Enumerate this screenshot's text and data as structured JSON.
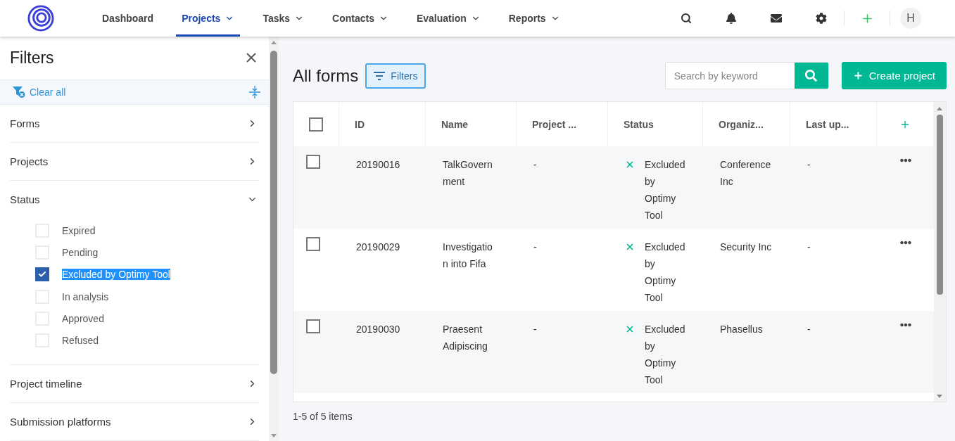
{
  "nav": {
    "items": [
      {
        "label": "Dashboard",
        "dropdown": false,
        "selected": false
      },
      {
        "label": "Projects",
        "dropdown": true,
        "selected": true
      },
      {
        "label": "Tasks",
        "dropdown": true,
        "selected": false
      },
      {
        "label": "Contacts",
        "dropdown": true,
        "selected": false
      },
      {
        "label": "Evaluation",
        "dropdown": true,
        "selected": false
      },
      {
        "label": "Reports",
        "dropdown": true,
        "selected": false
      }
    ],
    "avatar": "H"
  },
  "filters": {
    "title": "Filters",
    "clear": "Clear all",
    "sections": [
      {
        "label": "Forms",
        "expanded": false
      },
      {
        "label": "Projects",
        "expanded": false
      },
      {
        "label": "Status",
        "expanded": true,
        "options": [
          {
            "label": "Expired",
            "checked": false,
            "highlighted": false
          },
          {
            "label": "Pending",
            "checked": false,
            "highlighted": false
          },
          {
            "label": "Excluded by Optimy Tool",
            "checked": true,
            "highlighted": true
          },
          {
            "label": "In analysis",
            "checked": false,
            "highlighted": false
          },
          {
            "label": "Approved",
            "checked": false,
            "highlighted": false
          },
          {
            "label": "Refused",
            "checked": false,
            "highlighted": false
          }
        ]
      },
      {
        "label": "Project timeline",
        "expanded": false
      },
      {
        "label": "Submission platforms",
        "expanded": false
      }
    ]
  },
  "main": {
    "title": "All forms",
    "filter_button": "Filters",
    "search": {
      "placeholder": "Search by keyword"
    },
    "create_button": "Create project",
    "table": {
      "select_all": false,
      "columns": [
        "ID",
        "Name",
        "Project ...",
        "Status",
        "Organiz...",
        "Last up..."
      ],
      "rows": [
        {
          "checked": false,
          "id": "20190016",
          "name": "TalkGovernment",
          "project": "-",
          "status": "Excluded by Optimy Tool",
          "organization": "Conference Inc",
          "last_updated": "-"
        },
        {
          "checked": false,
          "id": "20190029",
          "name": "Investigation into Fifa",
          "project": "-",
          "status": "Excluded by Optimy Tool",
          "organization": "Security Inc",
          "last_updated": "-"
        },
        {
          "checked": false,
          "id": "20190030",
          "name": "Praesent Adipiscing",
          "project": "-",
          "status": "Excluded by Optimy Tool",
          "organization": "Phasellus",
          "last_updated": "-"
        }
      ]
    },
    "footer": "1-5 of 5 items"
  }
}
